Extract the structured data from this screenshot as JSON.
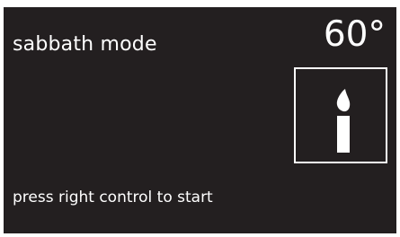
{
  "display": {
    "mode_title": "sabbath mode",
    "temperature": "60°",
    "status_icon": "candle-icon",
    "prompt": "press right control to start"
  },
  "colors": {
    "screen_background": "#231f20",
    "foreground": "#ffffff",
    "page_background": "#ffffff"
  }
}
